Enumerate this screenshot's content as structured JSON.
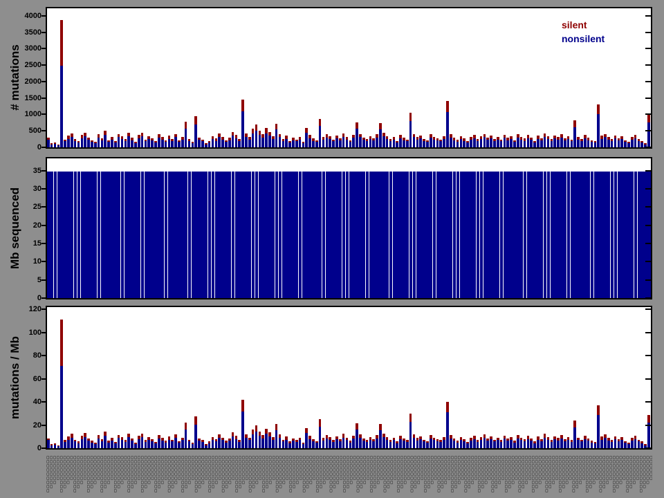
{
  "figure": {
    "background_color": "#8e8e8e",
    "plot_background": "#ffffff",
    "axis_color": "#000000"
  },
  "legend": {
    "items": [
      {
        "label": "silent",
        "color": "#8f0000"
      },
      {
        "label": "nonsilent",
        "color": "#00008c"
      }
    ],
    "position": "top-right of first panel"
  },
  "xaxis": {
    "note": "~180 per-sample labels rendered vertically in ~6px type; illegible at this resolution",
    "placeholder_char": "□",
    "count": 180
  },
  "chart_data": [
    {
      "type": "bar",
      "stacked": true,
      "ylabel": "# mutations",
      "ylim": [
        0,
        4230
      ],
      "yticks": [
        0,
        500,
        1000,
        1500,
        2000,
        2500,
        3000,
        3500,
        4000
      ],
      "n_samples": 180,
      "grid": false,
      "legend_position": "upper right",
      "x_note": "one stacked bar per sample; sample labels illegible",
      "series": [
        {
          "name": "nonsilent",
          "color": "#00008c",
          "values": [
            240,
            90,
            110,
            60,
            2480,
            180,
            260,
            310,
            200,
            150,
            280,
            340,
            230,
            160,
            120,
            290,
            210,
            380,
            170,
            230,
            150,
            310,
            260,
            190,
            340,
            220,
            120,
            280,
            330,
            180,
            250,
            210,
            140,
            300,
            230,
            170,
            260,
            200,
            310,
            160,
            240,
            560,
            200,
            130,
            700,
            230,
            180,
            90,
            150,
            260,
            200,
            310,
            240,
            170,
            220,
            350,
            280,
            190,
            1100,
            320,
            240,
            420,
            500,
            380,
            300,
            430,
            360,
            250,
            540,
            310,
            200,
            260,
            150,
            220,
            180,
            240,
            130,
            450,
            280,
            200,
            160,
            650,
            230,
            300,
            250,
            180,
            270,
            210,
            320,
            240,
            170,
            290,
            560,
            310,
            230,
            190,
            260,
            210,
            300,
            550,
            330,
            260,
            190,
            240,
            150,
            280,
            220,
            180,
            800,
            310,
            230,
            270,
            200,
            160,
            290,
            240,
            210,
            180,
            250,
            1080,
            300,
            220,
            170,
            260,
            200,
            140,
            230,
            280,
            190,
            250,
            310,
            230,
            270,
            200,
            240,
            180,
            290,
            220,
            260,
            170,
            300,
            240,
            200,
            280,
            230,
            150,
            260,
            210,
            320,
            250,
            190,
            270,
            230,
            300,
            210,
            260,
            180,
            620,
            240,
            200,
            280,
            220,
            170,
            140,
            1000,
            260,
            310,
            230,
            190,
            270,
            210,
            250,
            160,
            120,
            230,
            280,
            200,
            150,
            90,
            760
          ]
        },
        {
          "name": "silent",
          "color": "#8f0000",
          "values": [
            60,
            30,
            40,
            25,
            1400,
            60,
            90,
            120,
            60,
            50,
            90,
            110,
            70,
            60,
            40,
            100,
            60,
            130,
            50,
            80,
            40,
            90,
            80,
            60,
            100,
            70,
            40,
            90,
            110,
            60,
            80,
            70,
            50,
            100,
            80,
            50,
            90,
            60,
            100,
            50,
            80,
            210,
            60,
            40,
            250,
            70,
            60,
            30,
            50,
            80,
            70,
            110,
            80,
            50,
            70,
            120,
            90,
            60,
            350,
            100,
            80,
            140,
            190,
            120,
            100,
            150,
            110,
            80,
            180,
            100,
            60,
            90,
            50,
            70,
            60,
            80,
            40,
            150,
            90,
            70,
            50,
            220,
            80,
            100,
            80,
            60,
            90,
            70,
            110,
            80,
            50,
            90,
            190,
            100,
            70,
            60,
            80,
            70,
            100,
            180,
            110,
            80,
            60,
            80,
            50,
            90,
            70,
            60,
            250,
            100,
            80,
            90,
            60,
            50,
            100,
            80,
            70,
            60,
            80,
            320,
            100,
            70,
            60,
            80,
            70,
            50,
            80,
            90,
            60,
            80,
            100,
            70,
            90,
            60,
            80,
            60,
            90,
            70,
            80,
            50,
            100,
            80,
            70,
            90,
            70,
            50,
            90,
            60,
            110,
            80,
            60,
            90,
            80,
            100,
            70,
            80,
            60,
            210,
            80,
            60,
            90,
            70,
            50,
            40,
            300,
            90,
            100,
            80,
            60,
            90,
            70,
            80,
            50,
            40,
            80,
            90,
            60,
            50,
            30,
            240
          ]
        }
      ]
    },
    {
      "type": "bar",
      "stacked": false,
      "ylabel": "Mb sequenced",
      "ylim": [
        0,
        38.4
      ],
      "yticks": [
        0,
        5,
        10,
        15,
        20,
        25,
        30,
        35
      ],
      "n_samples": 180,
      "grid": false,
      "uniform_value": 34.8,
      "color": "#00008c",
      "note": "all 180 samples have ~34.8 Mb sequenced (visually uniform bars just under the 35 tick)"
    },
    {
      "type": "bar",
      "stacked": true,
      "ylabel": "mutations / Mb",
      "ylim": [
        0,
        122
      ],
      "yticks": [
        0,
        20,
        40,
        60,
        80,
        100,
        120
      ],
      "n_samples": 180,
      "grid": false,
      "derived": "per-sample mutation counts from panel 1 divided by Mb sequenced (34.8); peak sample ~111.5 total (~71.3 nonsilent)",
      "series_names": [
        "nonsilent",
        "silent"
      ],
      "colors": [
        "#00008c",
        "#8f0000"
      ]
    }
  ]
}
